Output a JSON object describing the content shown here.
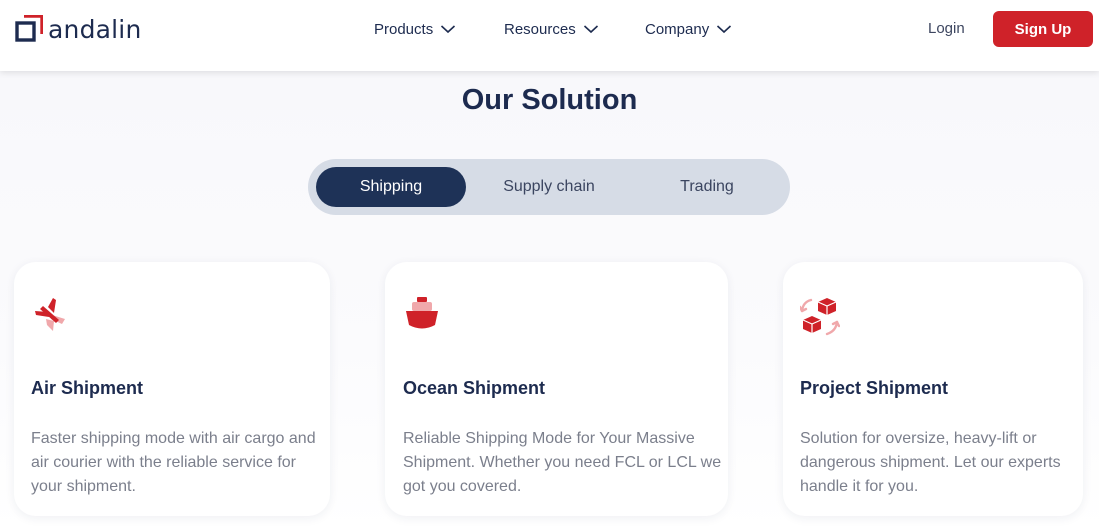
{
  "brand": {
    "name": "andalin",
    "accent": "#cf2229",
    "navy": "#1d2b4f"
  },
  "nav": {
    "items": [
      {
        "label": "Products",
        "icon": "chevron-down-icon"
      },
      {
        "label": "Resources",
        "icon": "chevron-down-icon"
      },
      {
        "label": "Company",
        "icon": "chevron-down-icon"
      }
    ],
    "login_label": "Login",
    "signup_label": "Sign Up"
  },
  "main": {
    "title": "Our Solution",
    "tabs": [
      {
        "label": "Shipping",
        "active": true
      },
      {
        "label": "Supply chain",
        "active": false
      },
      {
        "label": "Trading",
        "active": false
      }
    ],
    "cards": [
      {
        "icon": "airplane-icon",
        "title": "Air Shipment",
        "description": "Faster shipping mode with air cargo and air courier with the reliable service for your shipment."
      },
      {
        "icon": "ship-icon",
        "title": "Ocean Shipment",
        "description": "Reliable Shipping Mode for Your Massive Shipment. Whether you need FCL or LCL we got you covered."
      },
      {
        "icon": "boxes-cycle-icon",
        "title": "Project Shipment",
        "description": "Solution for oversize, heavy-lift or dangerous shipment. Let our experts handle it for you."
      }
    ]
  }
}
